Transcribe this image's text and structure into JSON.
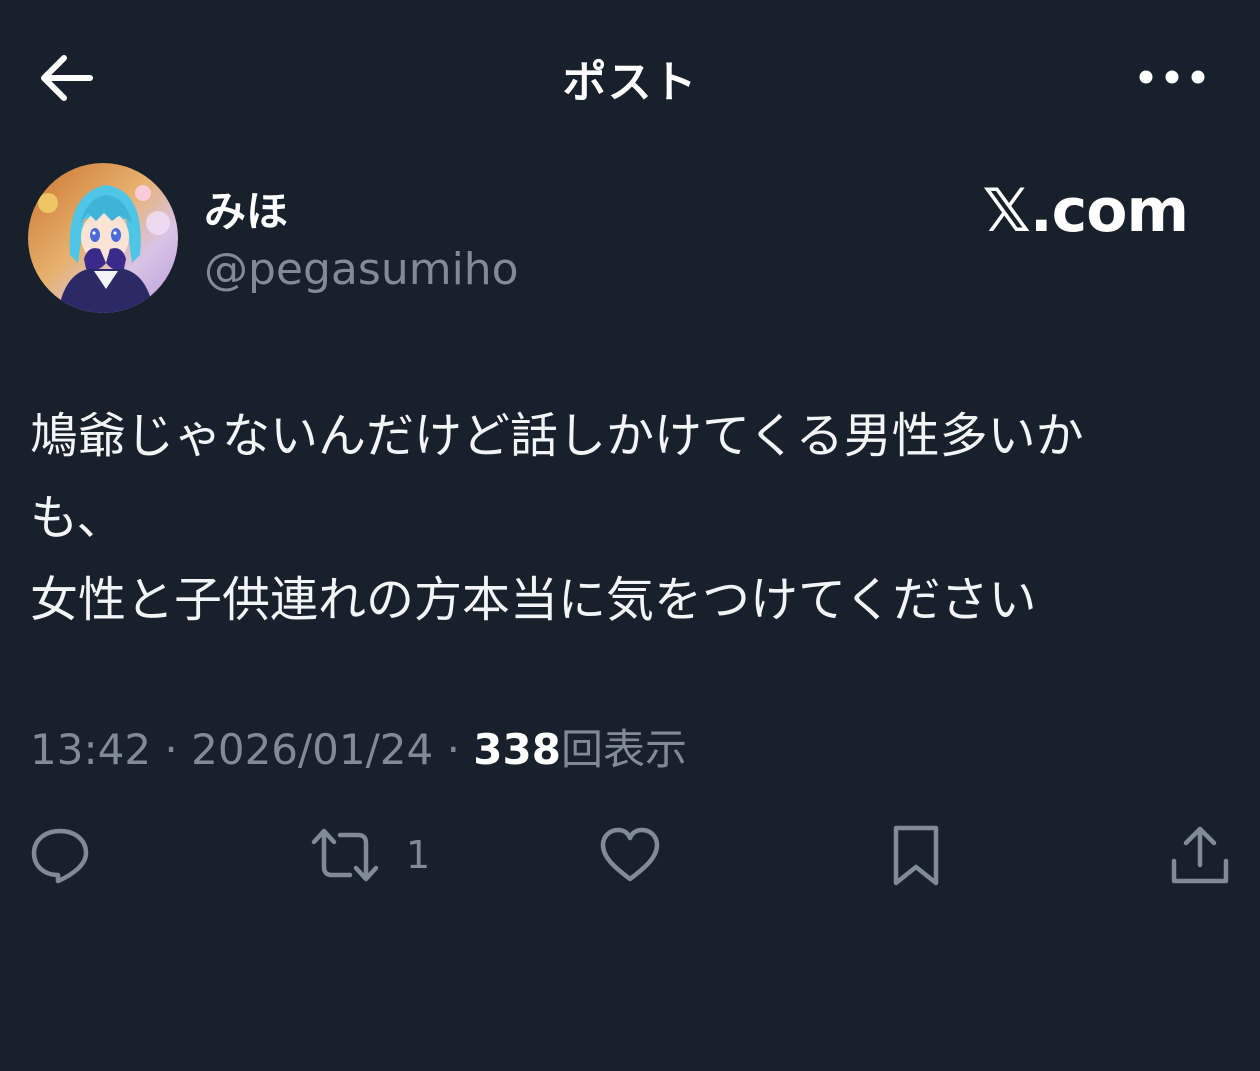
{
  "header": {
    "title": "ポスト",
    "back_icon": "arrow-left-icon",
    "more_icon": "more-horizontal-icon"
  },
  "author": {
    "display_name": "みほ",
    "handle": "@pegasumiho"
  },
  "watermark": "𝕏.com",
  "post": {
    "text": "鳩爺じゃないんだけど話しかけてくる男性多いか\nも、\n女性と子供連れの方本当に気をつけてください"
  },
  "meta": {
    "time": "13:42",
    "separator": "·",
    "date": "2026/01/24",
    "views_count": "338",
    "views_label": "回表示"
  },
  "actions": {
    "reply_icon": "reply-bubble-icon",
    "repost_icon": "repost-icon",
    "repost_count": "1",
    "like_icon": "heart-icon",
    "bookmark_icon": "bookmark-icon",
    "share_icon": "share-icon"
  },
  "colors": {
    "background": "#18202b",
    "text_primary": "#ffffff",
    "text_secondary": "#808b97"
  }
}
